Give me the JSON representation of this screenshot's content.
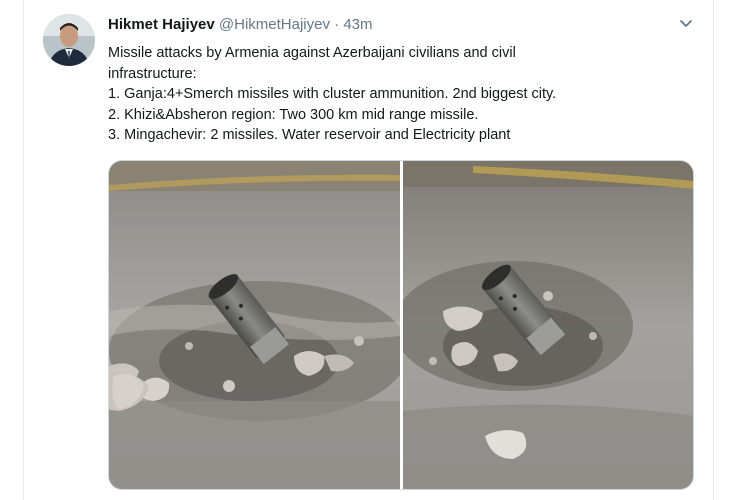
{
  "tweet": {
    "author_name": "Hikmet Hajiyev",
    "author_handle": "@HikmetHajiyev",
    "separator": "·",
    "timestamp": "43m",
    "lines": [
      "Missile attacks by Armenia against Azerbaijani civilians and civil",
      "infrastructure:",
      "1. Ganja:4+Smerch missiles with cluster ammunition. 2nd biggest city.",
      "2. Khizi&Absheron region: Two 300 km mid range missile.",
      "3. Mingachevir: 2 missiles. Water reservoir and Electricity plant"
    ]
  },
  "icons": {
    "menu": "chevron-down-icon",
    "avatar": "profile-photo"
  },
  "colors": {
    "name": "#14171a",
    "secondary": "#657786",
    "border": "#e6ecf0"
  }
}
